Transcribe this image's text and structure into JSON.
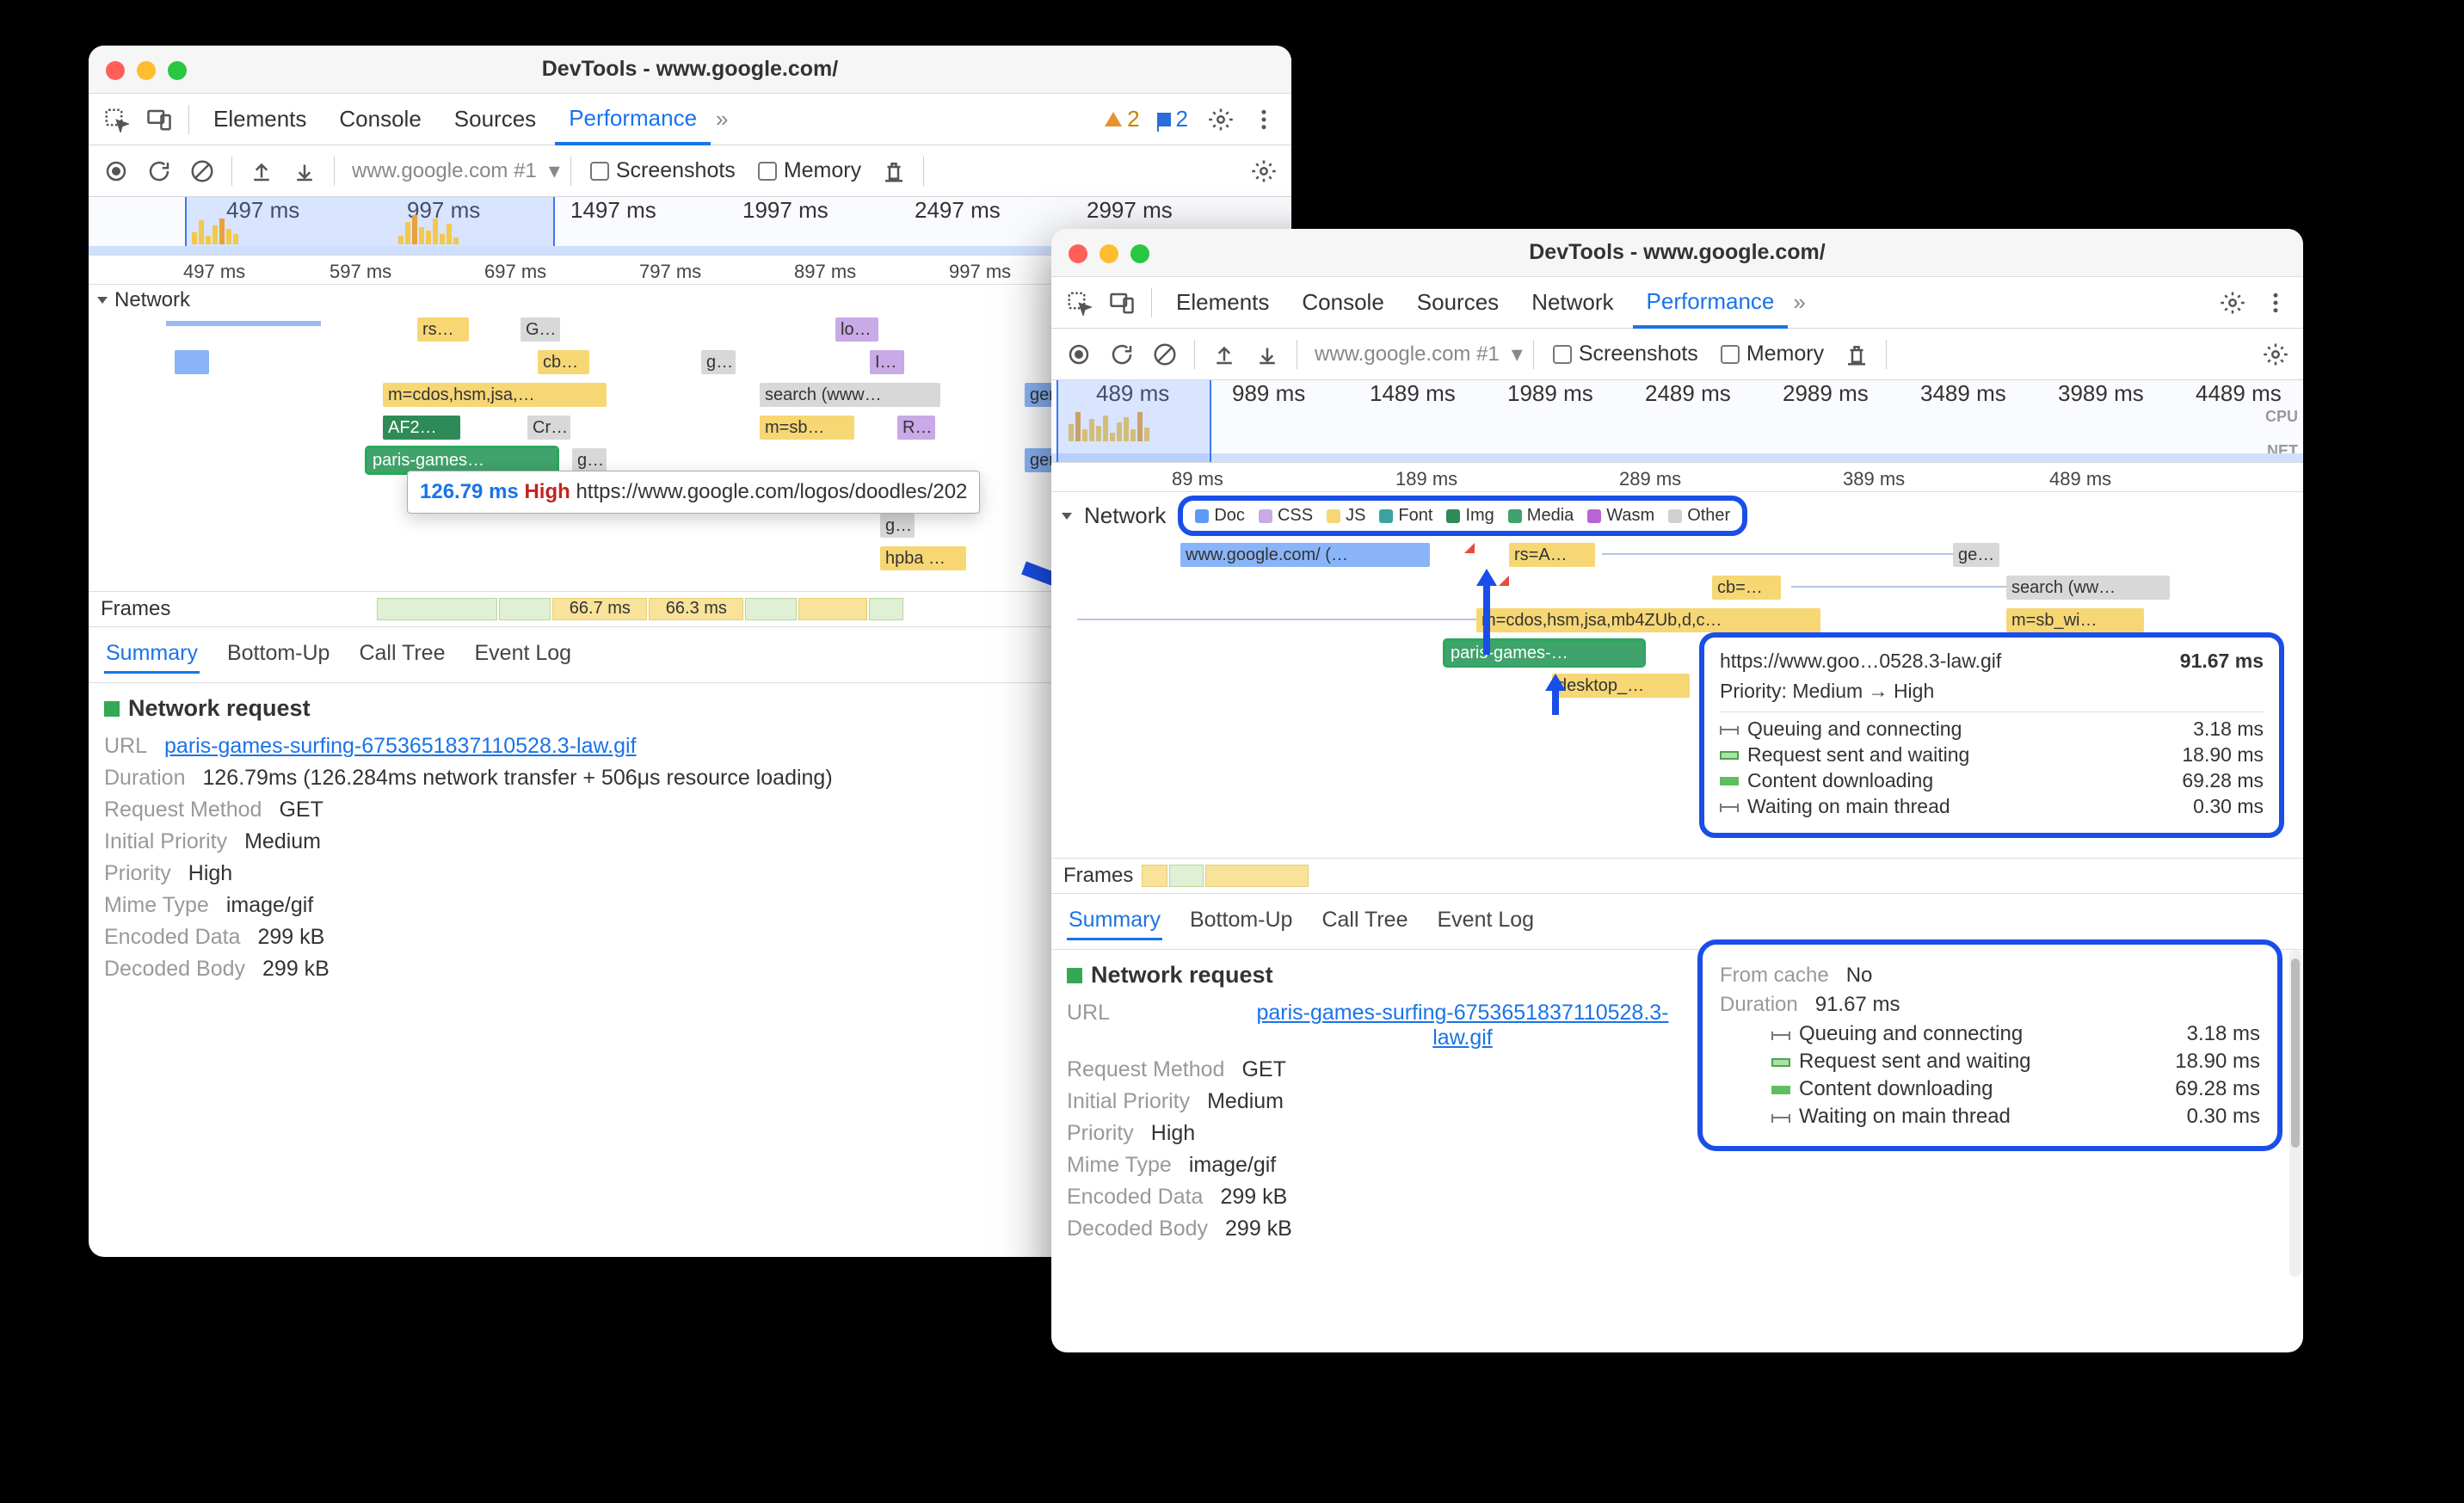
{
  "w1": {
    "title": "DevTools - www.google.com/",
    "tabs": [
      "Elements",
      "Console",
      "Sources",
      "Performance"
    ],
    "active_tab": 3,
    "warn_count": "2",
    "issue_count": "2",
    "host": "www.google.com #1",
    "cb_screenshots": "Screenshots",
    "cb_memory": "Memory",
    "overview_ticks": [
      "497 ms",
      "997 ms",
      "1497 ms",
      "1997 ms",
      "2497 ms",
      "2997 ms"
    ],
    "ruler_ticks": [
      "497 ms",
      "597 ms",
      "697 ms",
      "797 ms",
      "897 ms",
      "997 ms"
    ],
    "network_label": "Network",
    "bars": {
      "rs": "rs…",
      "g1": "G…",
      "cb": "cb…",
      "ge": "g…",
      "lo": "lo…",
      "iellip": "I…",
      "mcdos": "m=cdos,hsm,jsa,…",
      "search": "search (www…",
      "gen204a": "gen…",
      "af2": "AF2…",
      "cr": "Cr…",
      "msb": "m=sb…",
      "r": "R…",
      "paris": "paris-games…",
      "g2": "g…",
      "gen204b": "gen…",
      "ge2": "ge…",
      "g3": "g…",
      "hpba": "hpba …"
    },
    "tooltip": {
      "time": "126.79 ms",
      "priority": "High",
      "url": "https://www.google.com/logos/doodles/202"
    },
    "frames_label": "Frames",
    "frame_a": "66.7 ms",
    "frame_b": "66.3 ms",
    "subtabs": [
      "Summary",
      "Bottom-Up",
      "Call Tree",
      "Event Log"
    ],
    "subtab_active": 0,
    "panel_title": "Network request",
    "kv": {
      "url_k": "URL",
      "url_v": "paris-games-surfing-6753651837110528.3-law.gif",
      "dur_k": "Duration",
      "dur_v": "126.79ms (126.284ms network transfer + 506μs resource loading)",
      "rm_k": "Request Method",
      "rm_v": "GET",
      "ip_k": "Initial Priority",
      "ip_v": "Medium",
      "p_k": "Priority",
      "p_v": "High",
      "mt_k": "Mime Type",
      "mt_v": "image/gif",
      "ed_k": "Encoded Data",
      "ed_v": "299 kB",
      "db_k": "Decoded Body",
      "db_v": "299 kB"
    }
  },
  "w2": {
    "title": "DevTools - www.google.com/",
    "tabs": [
      "Elements",
      "Console",
      "Sources",
      "Network",
      "Performance"
    ],
    "active_tab": 4,
    "host": "www.google.com #1",
    "cb_screenshots": "Screenshots",
    "cb_memory": "Memory",
    "overview_ticks": [
      "489 ms",
      "989 ms",
      "1489 ms",
      "1989 ms",
      "2489 ms",
      "2989 ms",
      "3489 ms",
      "3989 ms",
      "4489 ms"
    ],
    "cpu": "CPU",
    "net": "NET",
    "ruler_ticks": [
      "89 ms",
      "189 ms",
      "289 ms",
      "389 ms",
      "489 ms"
    ],
    "network_label": "Network",
    "legend": [
      {
        "c": "#5a9bf6",
        "t": "Doc"
      },
      {
        "c": "#c9a9e6",
        "t": "CSS"
      },
      {
        "c": "#f6d774",
        "t": "JS"
      },
      {
        "c": "#39a3a0",
        "t": "Font"
      },
      {
        "c": "#2e8b57",
        "t": "Img"
      },
      {
        "c": "#3fa36b",
        "t": "Media"
      },
      {
        "c": "#b764d4",
        "t": "Wasm"
      },
      {
        "c": "#d0d0d0",
        "t": "Other"
      }
    ],
    "bars": {
      "gcom": "www.google.com/ (…",
      "rsA": "rs=A…",
      "ge": "ge…",
      "cb": "cb=…",
      "search": "search (ww…",
      "mcdos": "m=cdos,hsm,jsa,mb4ZUb,d,c…",
      "msb": "m=sb_wi…",
      "paris": "paris-games-…",
      "desktop": "desktop_…"
    },
    "tooltip": {
      "url": "https://www.goo…0528.3-law.gif",
      "time": "91.67 ms",
      "pri_label": "Priority: ",
      "pri_from": "Medium",
      "pri_to": "High",
      "rows": [
        {
          "l": "Queuing and connecting",
          "v": "3.18 ms",
          "seg": "d"
        },
        {
          "l": "Request sent and waiting",
          "v": "18.90 ms",
          "seg": "b"
        },
        {
          "l": "Content downloading",
          "v": "69.28 ms",
          "seg": "c"
        },
        {
          "l": "Waiting on main thread",
          "v": "0.30 ms",
          "seg": "d"
        }
      ]
    },
    "frames_label": "Frames",
    "subtabs": [
      "Summary",
      "Bottom-Up",
      "Call Tree",
      "Event Log"
    ],
    "subtab_active": 0,
    "panel_title": "Network request",
    "kv": {
      "url_k": "URL",
      "url_v": "paris-games-surfing-6753651837110528.3-law.gif",
      "rm_k": "Request Method",
      "rm_v": "GET",
      "ip_k": "Initial Priority",
      "ip_v": "Medium",
      "p_k": "Priority",
      "p_v": "High",
      "mt_k": "Mime Type",
      "mt_v": "image/gif",
      "ed_k": "Encoded Data",
      "ed_v": "299 kB",
      "db_k": "Decoded Body",
      "db_v": "299 kB"
    },
    "dur": {
      "fc_k": "From cache",
      "fc_v": "No",
      "d_k": "Duration",
      "d_v": "91.67 ms",
      "rows": [
        {
          "l": "Queuing and connecting",
          "v": "3.18 ms",
          "seg": "d"
        },
        {
          "l": "Request sent and waiting",
          "v": "18.90 ms",
          "seg": "b"
        },
        {
          "l": "Content downloading",
          "v": "69.28 ms",
          "seg": "c"
        },
        {
          "l": "Waiting on main thread",
          "v": "0.30 ms",
          "seg": "d"
        }
      ]
    }
  }
}
